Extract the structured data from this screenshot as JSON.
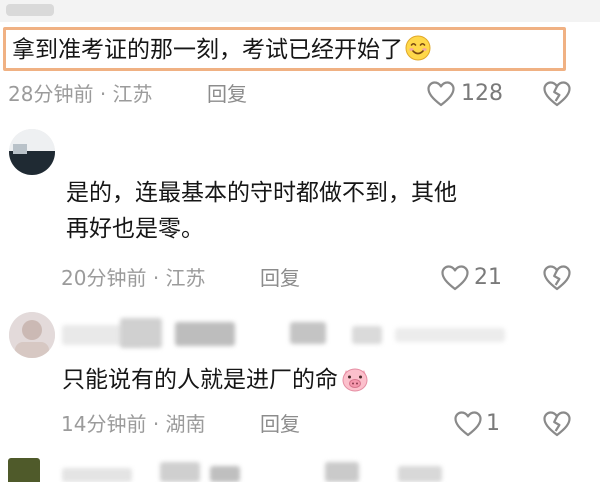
{
  "comments": [
    {
      "text": "拿到准考证的那一刻，考试已经开始了",
      "emoji": "smile-emoji",
      "time": "28分钟前",
      "location": "江苏",
      "reply_label": "回复",
      "likes": "128",
      "highlighted": true
    },
    {
      "text": "是的，连最基本的守时都做不到，其他再好也是零。",
      "time": "20分钟前",
      "location": "江苏",
      "reply_label": "回复",
      "likes": "21"
    },
    {
      "text": "只能说有的人就是进厂的命",
      "emoji": "pig-emoji",
      "time": "14分钟前",
      "location": "湖南",
      "reply_label": "回复",
      "likes": "1"
    }
  ],
  "colors": {
    "highlight_border": "#f0b183",
    "meta_text": "#9b9b9b",
    "icon_stroke": "#8a8a8a"
  }
}
